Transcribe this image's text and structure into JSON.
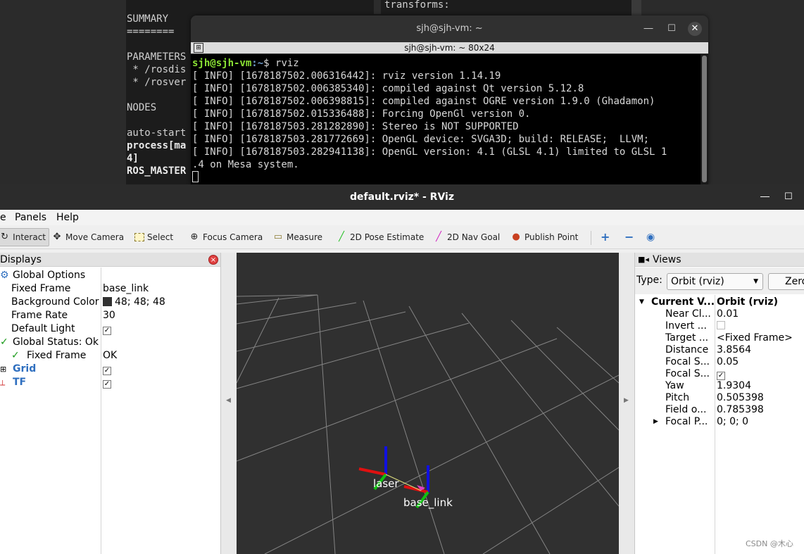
{
  "bg_terminal": {
    "left_lines": [
      "SUMMARY",
      "========",
      "",
      "PARAMETERS",
      " * /rosdis",
      " * /rosver",
      "",
      "NODES",
      "",
      "auto-start",
      "process[ma",
      "4]",
      "ROS_MASTER"
    ],
    "right_line": "transforms:"
  },
  "terminal": {
    "title": "sjh@sjh-vm: ~",
    "tab_label": "sjh@sjh-vm: ~ 80x24",
    "prompt_user": "sjh@sjh-vm",
    "prompt_path": ":~",
    "prompt_command": "$ rviz",
    "lines": [
      "[ INFO] [1678187502.006316442]: rviz version 1.14.19",
      "[ INFO] [1678187502.006385340]: compiled against Qt version 5.12.8",
      "[ INFO] [1678187502.006398815]: compiled against OGRE version 1.9.0 (Ghadamon)",
      "[ INFO] [1678187502.015336488]: Forcing OpenGl version 0.",
      "[ INFO] [1678187503.281282890]: Stereo is NOT SUPPORTED",
      "[ INFO] [1678187503.281772669]: OpenGL device: SVGA3D; build: RELEASE;  LLVM;",
      "[ INFO] [1678187503.282941138]: OpenGL version: 4.1 (GLSL 4.1) limited to GLSL 1",
      ".4 on Mesa system."
    ]
  },
  "rviz": {
    "title": "default.rviz* - RViz",
    "menu": [
      "e",
      "Panels",
      "Help"
    ],
    "toolbar": {
      "interact": "Interact",
      "move_camera": "Move Camera",
      "select": "Select",
      "focus_camera": "Focus Camera",
      "measure": "Measure",
      "pose_estimate": "2D Pose Estimate",
      "nav_goal": "2D Nav Goal",
      "publish_point": "Publish Point"
    },
    "displays": {
      "title": "Displays",
      "rows": {
        "global_options": "Global Options",
        "fixed_frame_label": "Fixed Frame",
        "fixed_frame_value": "base_link",
        "bg_color_label": "Background Color",
        "bg_color_value": "48; 48; 48",
        "frame_rate_label": "Frame Rate",
        "frame_rate_value": "30",
        "default_light_label": "Default Light",
        "global_status": "Global Status: Ok",
        "status_fixed_frame": "Fixed Frame",
        "status_fixed_frame_value": "OK",
        "grid": "Grid",
        "tf": "TF"
      },
      "bg_swatch_color": "#303030"
    },
    "view3d": {
      "labels": [
        "laser",
        "base_link"
      ],
      "background": "#303030"
    },
    "views": {
      "title": "Views",
      "type_label": "Type:",
      "type_value": "Orbit (rviz)",
      "zero_label": "Zero",
      "current_view_label": "Current V...",
      "current_view_value": "Orbit (rviz)",
      "props": [
        {
          "k": "Near Cl...",
          "v": "0.01"
        },
        {
          "k": "Invert ...",
          "v": ""
        },
        {
          "k": "Target ...",
          "v": "<Fixed Frame>"
        },
        {
          "k": "Distance",
          "v": "3.8564"
        },
        {
          "k": "Focal S...",
          "v": "0.05"
        },
        {
          "k": "Focal S...",
          "v": ""
        },
        {
          "k": "Yaw",
          "v": "1.9304"
        },
        {
          "k": "Pitch",
          "v": "0.505398"
        },
        {
          "k": "Field o...",
          "v": "0.785398"
        },
        {
          "k": "Focal P...",
          "v": "0; 0; 0"
        }
      ]
    }
  },
  "watermark": "CSDN @木心"
}
